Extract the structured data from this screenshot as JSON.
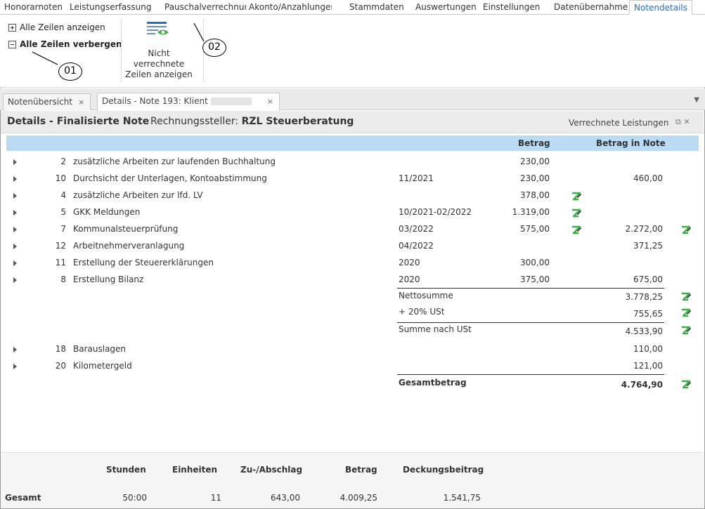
{
  "menu": {
    "items": [
      "Honorarnoten",
      "Leistungserfassung",
      "Pauschalverrechnung",
      "Akonto/Anzahlungen",
      "Stammdaten",
      "Auswertungen",
      "Einstellungen",
      "Datenübernahme",
      "Notendetails"
    ],
    "active": "Notendetails"
  },
  "ribbon": {
    "show_all": "Alle Zeilen anzeigen",
    "hide_all": "Alle Zeilen verbergen",
    "show_unbilled_line1": "Nicht verrechnete",
    "show_unbilled_line2": "Zeilen anzeigen"
  },
  "callouts": [
    "01",
    "02"
  ],
  "doc_tabs": {
    "overview": "Notenübersicht",
    "details": "Details - Note 193: Klient",
    "close": "×"
  },
  "details_header": {
    "title": "Details - Finalisierte Note",
    "issuer_label": "Rechnungssteller:",
    "issuer_name": "RZL Steuerberatung",
    "right_label": "Verrechnete Leistungen"
  },
  "grid": {
    "col_betrag": "Betrag",
    "col_betrag_in_note": "Betrag in Note",
    "rows": [
      {
        "nr": "2",
        "desc": "zusätzliche Arbeiten zur laufenden Buchhaltung",
        "period": "",
        "betrag": "230,00",
        "note": ""
      },
      {
        "nr": "10",
        "desc": "Durchsicht der Unterlagen, Kontoabstimmung",
        "period": "11/2021",
        "betrag": "230,00",
        "note": "460,00"
      },
      {
        "nr": "4",
        "desc": "zusätzliche Arbeiten zur lfd. LV",
        "period": "",
        "betrag": "378,00",
        "note": ""
      },
      {
        "nr": "5",
        "desc": "GKK Meldungen",
        "period": "10/2021-02/2022",
        "betrag": "1.319,00",
        "note": ""
      },
      {
        "nr": "7",
        "desc": "Kommunalsteuerprüfung",
        "period": "03/2022",
        "betrag": "575,00",
        "note": "2.272,00"
      },
      {
        "nr": "12",
        "desc": "Arbeitnehmerveranlagung",
        "period": "04/2022",
        "betrag": "",
        "note": "371,25"
      },
      {
        "nr": "11",
        "desc": "Erstellung der Steuererklärungen",
        "period": "2020",
        "betrag": "300,00",
        "note": ""
      },
      {
        "nr": "8",
        "desc": "Erstellung Bilanz",
        "period": "2020",
        "betrag": "375,00",
        "note": "675,00"
      }
    ],
    "netto_label": "Nettosumme",
    "netto_value": "3.778,25",
    "ust_label": "+ 20% USt",
    "ust_value": "755,65",
    "summe_label": "Summe nach USt",
    "summe_value": "4.533,90",
    "extra_rows": [
      {
        "nr": "18",
        "desc": "Barauslagen",
        "note": "110,00"
      },
      {
        "nr": "20",
        "desc": "Kilometergeld",
        "note": "121,00"
      }
    ],
    "total_label": "Gesamtbetrag",
    "total_value": "4.764,90"
  },
  "summary": {
    "headers": [
      "Stunden",
      "Einheiten",
      "Zu-/Abschlag",
      "Betrag",
      "Deckungsbeitrag"
    ],
    "row_label": "Gesamt",
    "values": [
      "50:00",
      "11",
      "643,00",
      "4.009,25",
      "1.541,75"
    ]
  },
  "colors": {
    "accent_blue": "#2a6ebb",
    "grid_header": "#b9dbf3",
    "edit_icon_green": "#3fae49"
  },
  "icons": [
    "expand-square-icon",
    "collapse-square-icon",
    "unbilled-rows-eye-icon",
    "row-expand-arrow-icon",
    "edit-z-icon",
    "popout-icon",
    "close-icon",
    "chevron-down-icon"
  ]
}
